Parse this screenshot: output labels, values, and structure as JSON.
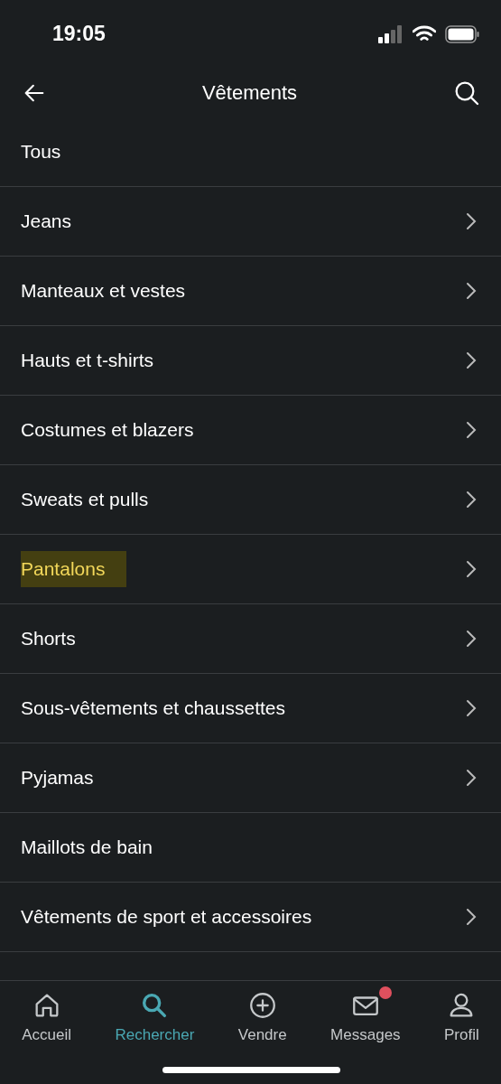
{
  "status_bar": {
    "time": "19:05"
  },
  "nav": {
    "title": "Vêtements"
  },
  "categories": [
    {
      "label": "Tous",
      "chevron": false,
      "highlighted": false
    },
    {
      "label": "Jeans",
      "chevron": true,
      "highlighted": false
    },
    {
      "label": "Manteaux et vestes",
      "chevron": true,
      "highlighted": false
    },
    {
      "label": "Hauts et t-shirts",
      "chevron": true,
      "highlighted": false
    },
    {
      "label": "Costumes et blazers",
      "chevron": true,
      "highlighted": false
    },
    {
      "label": "Sweats et pulls",
      "chevron": true,
      "highlighted": false
    },
    {
      "label": "Pantalons",
      "chevron": true,
      "highlighted": true
    },
    {
      "label": "Shorts",
      "chevron": true,
      "highlighted": false
    },
    {
      "label": "Sous-vêtements et chaussettes",
      "chevron": true,
      "highlighted": false
    },
    {
      "label": "Pyjamas",
      "chevron": true,
      "highlighted": false
    },
    {
      "label": "Maillots de bain",
      "chevron": false,
      "highlighted": false
    },
    {
      "label": "Vêtements de sport et accessoires",
      "chevron": true,
      "highlighted": false
    }
  ],
  "tab_bar": [
    {
      "kind": "home",
      "label": "Accueil",
      "selected": false,
      "badge": false
    },
    {
      "kind": "search",
      "label": "Rechercher",
      "selected": true,
      "badge": false
    },
    {
      "kind": "sell",
      "label": "Vendre",
      "selected": false,
      "badge": false
    },
    {
      "kind": "messages",
      "label": "Messages",
      "selected": false,
      "badge": true
    },
    {
      "kind": "profile",
      "label": "Profil",
      "selected": false,
      "badge": false
    }
  ]
}
